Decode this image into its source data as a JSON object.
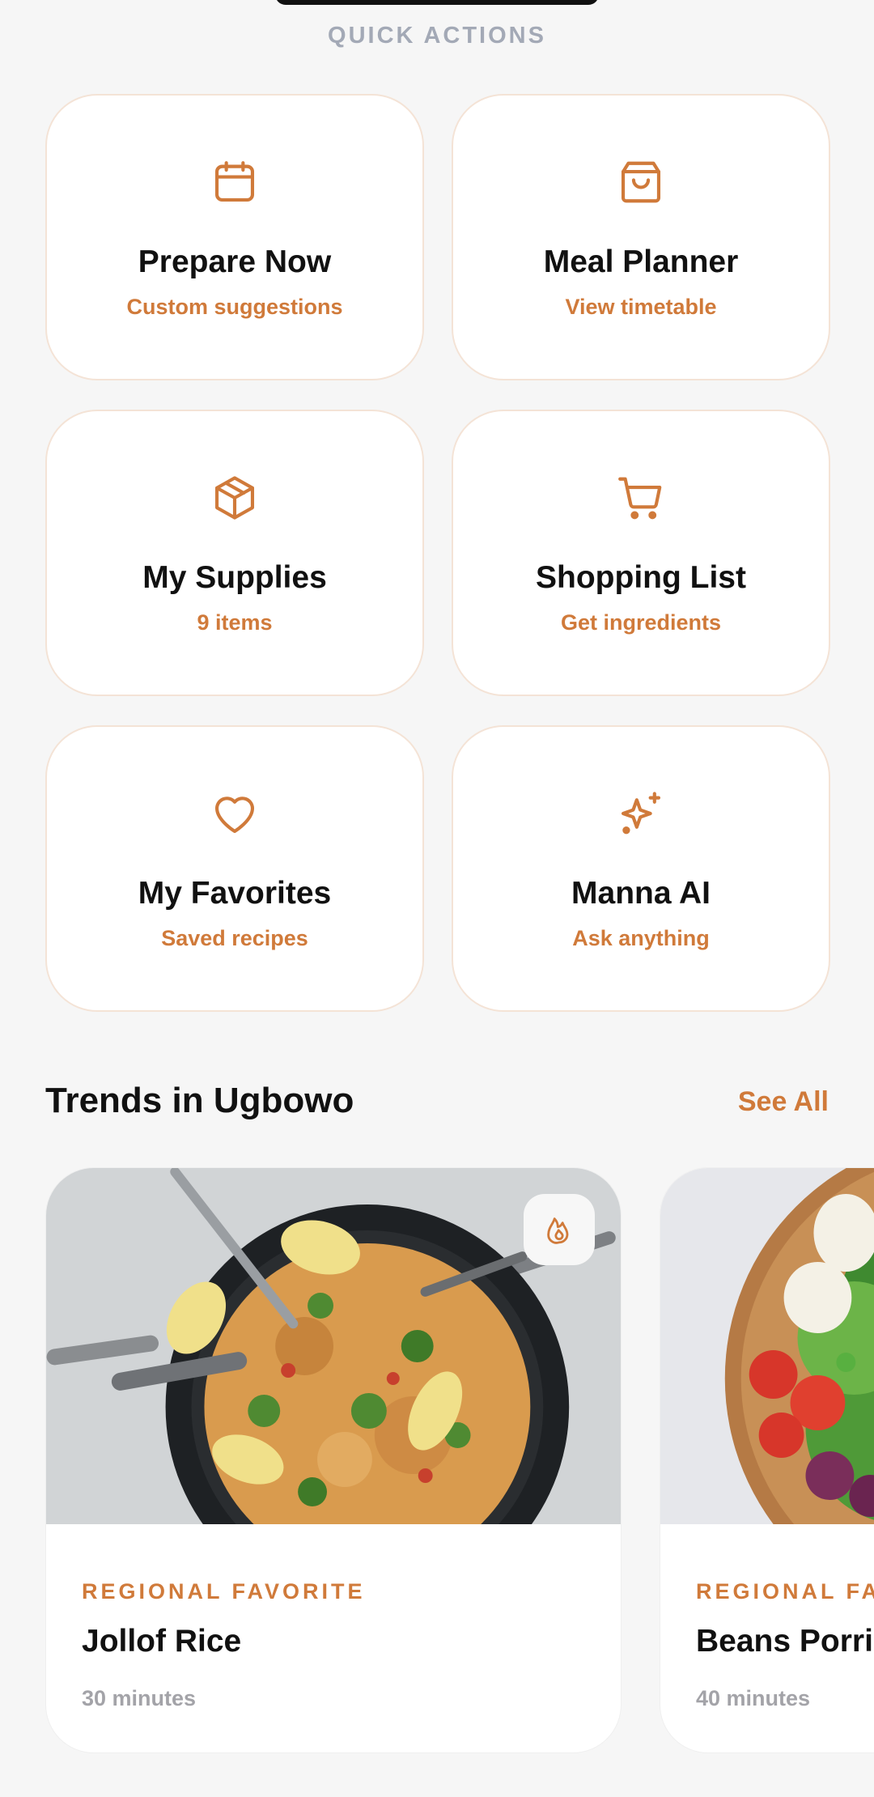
{
  "quick_actions": {
    "label": "QUICK ACTIONS",
    "accent_color": "#d07a3a",
    "items": [
      {
        "icon": "calendar-icon",
        "title": "Prepare Now",
        "subtitle": "Custom suggestions"
      },
      {
        "icon": "shopping-bag-icon",
        "title": "Meal Planner",
        "subtitle": "View timetable"
      },
      {
        "icon": "package-box-icon",
        "title": "My Supplies",
        "subtitle": "9 items"
      },
      {
        "icon": "shopping-cart-icon",
        "title": "Shopping List",
        "subtitle": "Get ingredients"
      },
      {
        "icon": "heart-icon",
        "title": "My Favorites",
        "subtitle": "Saved recipes"
      },
      {
        "icon": "sparkles-icon",
        "title": "Manna AI",
        "subtitle": "Ask anything"
      }
    ]
  },
  "trends": {
    "title": "Trends in Ugbowo",
    "see_all_label": "See All",
    "recipes": [
      {
        "tag": "REGIONAL FAVORITE",
        "name": "Jollof Rice",
        "time": "30 minutes",
        "badge_icon": "flame-icon"
      },
      {
        "tag": "REGIONAL FAVORITE",
        "name": "Beans Porridge",
        "time": "40 minutes"
      }
    ]
  }
}
